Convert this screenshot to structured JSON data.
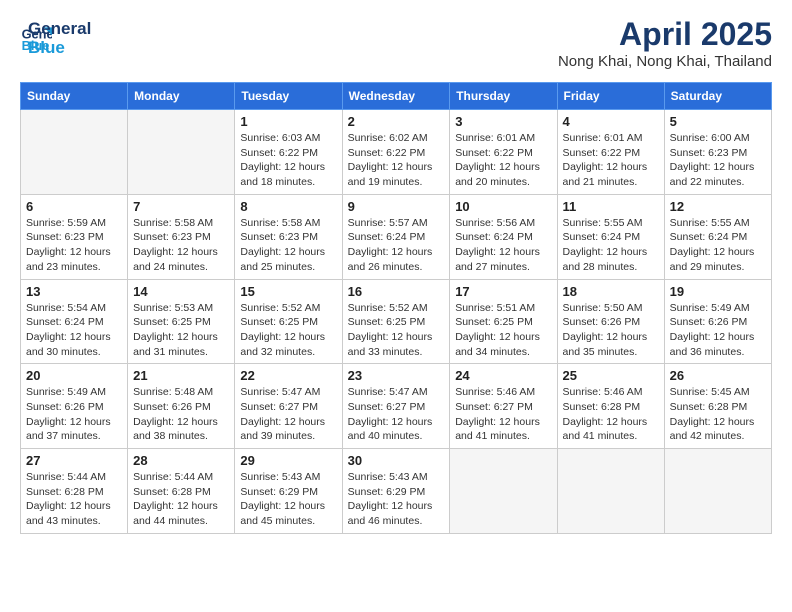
{
  "logo": {
    "line1": "General",
    "line2": "Blue"
  },
  "title": "April 2025",
  "location": "Nong Khai, Nong Khai, Thailand",
  "days_of_week": [
    "Sunday",
    "Monday",
    "Tuesday",
    "Wednesday",
    "Thursday",
    "Friday",
    "Saturday"
  ],
  "weeks": [
    [
      {
        "day": "",
        "info": ""
      },
      {
        "day": "",
        "info": ""
      },
      {
        "day": "1",
        "info": "Sunrise: 6:03 AM\nSunset: 6:22 PM\nDaylight: 12 hours and 18 minutes."
      },
      {
        "day": "2",
        "info": "Sunrise: 6:02 AM\nSunset: 6:22 PM\nDaylight: 12 hours and 19 minutes."
      },
      {
        "day": "3",
        "info": "Sunrise: 6:01 AM\nSunset: 6:22 PM\nDaylight: 12 hours and 20 minutes."
      },
      {
        "day": "4",
        "info": "Sunrise: 6:01 AM\nSunset: 6:22 PM\nDaylight: 12 hours and 21 minutes."
      },
      {
        "day": "5",
        "info": "Sunrise: 6:00 AM\nSunset: 6:23 PM\nDaylight: 12 hours and 22 minutes."
      }
    ],
    [
      {
        "day": "6",
        "info": "Sunrise: 5:59 AM\nSunset: 6:23 PM\nDaylight: 12 hours and 23 minutes."
      },
      {
        "day": "7",
        "info": "Sunrise: 5:58 AM\nSunset: 6:23 PM\nDaylight: 12 hours and 24 minutes."
      },
      {
        "day": "8",
        "info": "Sunrise: 5:58 AM\nSunset: 6:23 PM\nDaylight: 12 hours and 25 minutes."
      },
      {
        "day": "9",
        "info": "Sunrise: 5:57 AM\nSunset: 6:24 PM\nDaylight: 12 hours and 26 minutes."
      },
      {
        "day": "10",
        "info": "Sunrise: 5:56 AM\nSunset: 6:24 PM\nDaylight: 12 hours and 27 minutes."
      },
      {
        "day": "11",
        "info": "Sunrise: 5:55 AM\nSunset: 6:24 PM\nDaylight: 12 hours and 28 minutes."
      },
      {
        "day": "12",
        "info": "Sunrise: 5:55 AM\nSunset: 6:24 PM\nDaylight: 12 hours and 29 minutes."
      }
    ],
    [
      {
        "day": "13",
        "info": "Sunrise: 5:54 AM\nSunset: 6:24 PM\nDaylight: 12 hours and 30 minutes."
      },
      {
        "day": "14",
        "info": "Sunrise: 5:53 AM\nSunset: 6:25 PM\nDaylight: 12 hours and 31 minutes."
      },
      {
        "day": "15",
        "info": "Sunrise: 5:52 AM\nSunset: 6:25 PM\nDaylight: 12 hours and 32 minutes."
      },
      {
        "day": "16",
        "info": "Sunrise: 5:52 AM\nSunset: 6:25 PM\nDaylight: 12 hours and 33 minutes."
      },
      {
        "day": "17",
        "info": "Sunrise: 5:51 AM\nSunset: 6:25 PM\nDaylight: 12 hours and 34 minutes."
      },
      {
        "day": "18",
        "info": "Sunrise: 5:50 AM\nSunset: 6:26 PM\nDaylight: 12 hours and 35 minutes."
      },
      {
        "day": "19",
        "info": "Sunrise: 5:49 AM\nSunset: 6:26 PM\nDaylight: 12 hours and 36 minutes."
      }
    ],
    [
      {
        "day": "20",
        "info": "Sunrise: 5:49 AM\nSunset: 6:26 PM\nDaylight: 12 hours and 37 minutes."
      },
      {
        "day": "21",
        "info": "Sunrise: 5:48 AM\nSunset: 6:26 PM\nDaylight: 12 hours and 38 minutes."
      },
      {
        "day": "22",
        "info": "Sunrise: 5:47 AM\nSunset: 6:27 PM\nDaylight: 12 hours and 39 minutes."
      },
      {
        "day": "23",
        "info": "Sunrise: 5:47 AM\nSunset: 6:27 PM\nDaylight: 12 hours and 40 minutes."
      },
      {
        "day": "24",
        "info": "Sunrise: 5:46 AM\nSunset: 6:27 PM\nDaylight: 12 hours and 41 minutes."
      },
      {
        "day": "25",
        "info": "Sunrise: 5:46 AM\nSunset: 6:28 PM\nDaylight: 12 hours and 41 minutes."
      },
      {
        "day": "26",
        "info": "Sunrise: 5:45 AM\nSunset: 6:28 PM\nDaylight: 12 hours and 42 minutes."
      }
    ],
    [
      {
        "day": "27",
        "info": "Sunrise: 5:44 AM\nSunset: 6:28 PM\nDaylight: 12 hours and 43 minutes."
      },
      {
        "day": "28",
        "info": "Sunrise: 5:44 AM\nSunset: 6:28 PM\nDaylight: 12 hours and 44 minutes."
      },
      {
        "day": "29",
        "info": "Sunrise: 5:43 AM\nSunset: 6:29 PM\nDaylight: 12 hours and 45 minutes."
      },
      {
        "day": "30",
        "info": "Sunrise: 5:43 AM\nSunset: 6:29 PM\nDaylight: 12 hours and 46 minutes."
      },
      {
        "day": "",
        "info": ""
      },
      {
        "day": "",
        "info": ""
      },
      {
        "day": "",
        "info": ""
      }
    ]
  ]
}
